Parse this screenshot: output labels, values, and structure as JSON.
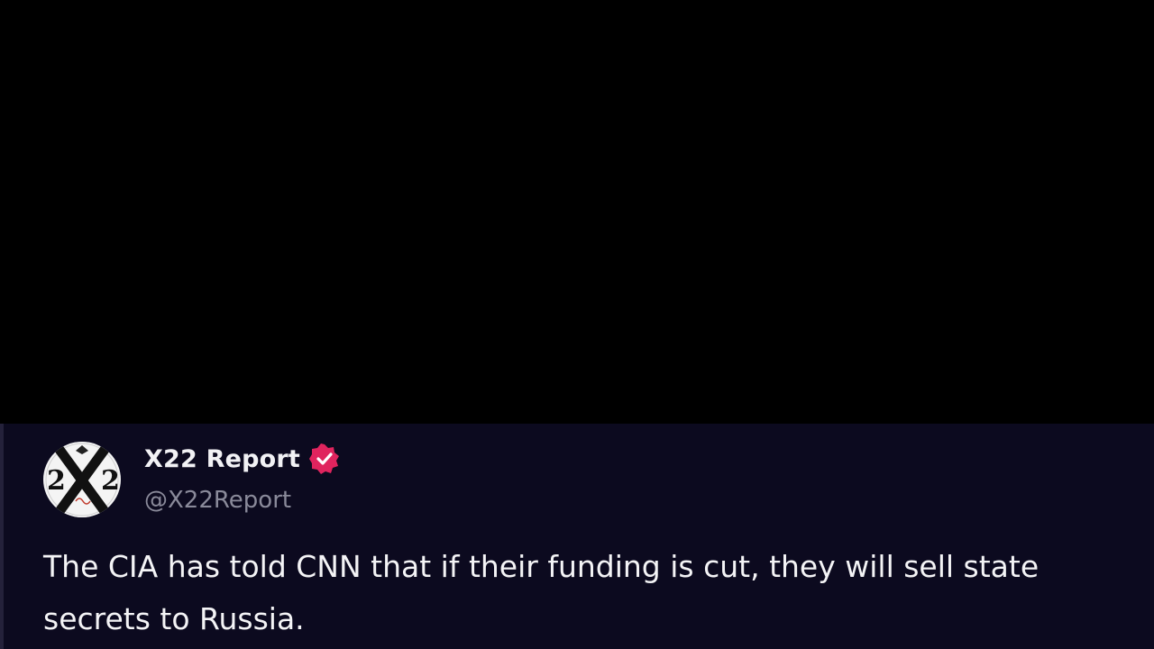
{
  "post": {
    "display_name": "X22 Report",
    "handle": "@X22Report",
    "text": "The CIA has told CNN that if their funding is cut, they will sell state secrets to Russia.",
    "verified_icon": "verified-badge-icon",
    "accent_color": "#e0245e"
  },
  "avatar": {
    "logo_text": "2X2"
  }
}
